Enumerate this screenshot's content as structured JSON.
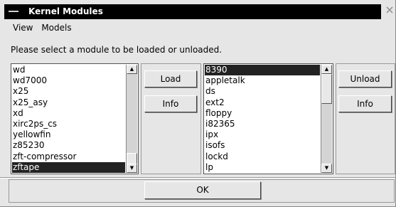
{
  "window": {
    "title": "Kernel Modules"
  },
  "menubar": {
    "items": [
      "View",
      "Models"
    ]
  },
  "instructions": "Please select a module to be loaded or unloaded.",
  "available_list": {
    "items": [
      "wd",
      "wd7000",
      "x25",
      "x25_asy",
      "xd",
      "xirc2ps_cs",
      "yellowfin",
      "z85230",
      "zft-compressor",
      "zftape"
    ],
    "selected": "zftape"
  },
  "loaded_list": {
    "items": [
      "8390",
      "appletalk",
      "ds",
      "ext2",
      "floppy",
      "i82365",
      "ipx",
      "isofs",
      "lockd",
      "lp"
    ],
    "selected": "8390"
  },
  "buttons": {
    "load": "Load",
    "info_left": "Info",
    "unload": "Unload",
    "info_right": "Info",
    "ok": "OK"
  },
  "icons": {
    "close": "×",
    "scroll_up": "▲",
    "scroll_down": "▼"
  }
}
